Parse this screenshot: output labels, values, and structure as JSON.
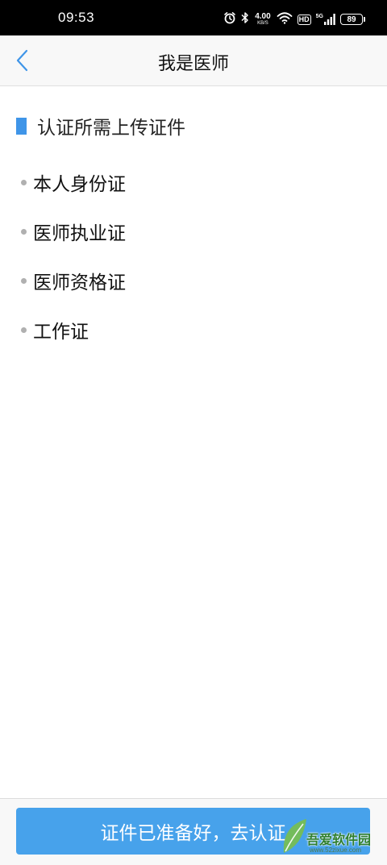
{
  "status_bar": {
    "time": "09:53",
    "net_speed_value": "4.00",
    "net_speed_unit": "KB/S",
    "hd_label": "HD",
    "signal_label": "5G",
    "battery_level": "89",
    "icons": [
      "alarm-icon",
      "bluetooth-icon",
      "wifi-icon",
      "signal-icon",
      "battery-icon"
    ]
  },
  "nav": {
    "title": "我是医师",
    "back_icon": "chevron-left-icon"
  },
  "section": {
    "title": "认证所需上传证件",
    "accent_color": "#3f95e8"
  },
  "documents": [
    {
      "label": "本人身份证"
    },
    {
      "label": "医师执业证"
    },
    {
      "label": "医师资格证"
    },
    {
      "label": "工作证"
    }
  ],
  "footer": {
    "button_label": "证件已准备好，去认证",
    "button_color": "#47a2eb"
  },
  "watermark": {
    "text": "吾爱软件园",
    "url": "www.52zixue.com"
  }
}
